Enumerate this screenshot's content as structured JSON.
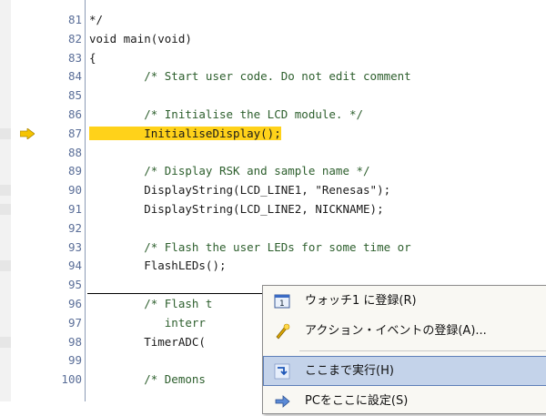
{
  "editor": {
    "lines": [
      {
        "no": "81",
        "code": "*/",
        "kind": "plain",
        "mark": false
      },
      {
        "no": "82",
        "code": "void main(void)",
        "kind": "plain",
        "mark": false
      },
      {
        "no": "83",
        "code": "{",
        "kind": "plain",
        "mark": false
      },
      {
        "no": "84",
        "code": "        /* Start user code. Do not edit comment",
        "kind": "comment",
        "mark": false
      },
      {
        "no": "85",
        "code": "",
        "kind": "plain",
        "mark": false
      },
      {
        "no": "86",
        "code": "        /* Initialise the LCD module. */",
        "kind": "comment",
        "mark": false
      },
      {
        "no": "87",
        "code": "        InitialiseDisplay();",
        "kind": "plain",
        "mark": true,
        "current": true
      },
      {
        "no": "88",
        "code": "",
        "kind": "plain",
        "mark": false
      },
      {
        "no": "89",
        "code": "        /* Display RSK and sample name */",
        "kind": "comment",
        "mark": false
      },
      {
        "no": "90",
        "code": "        DisplayString(LCD_LINE1, \"Renesas\");",
        "kind": "string",
        "mark": true
      },
      {
        "no": "91",
        "code": "        DisplayString(LCD_LINE2, NICKNAME);",
        "kind": "plain",
        "mark": true
      },
      {
        "no": "92",
        "code": "",
        "kind": "plain",
        "mark": false
      },
      {
        "no": "93",
        "code": "        /* Flash the user LEDs for some time or",
        "kind": "comment",
        "mark": false
      },
      {
        "no": "94",
        "code": "        FlashLEDs();",
        "kind": "plain",
        "mark": true
      },
      {
        "no": "95",
        "code": "",
        "kind": "plain",
        "mark": false
      },
      {
        "no": "96",
        "code": "        /* Flash t",
        "kind": "comment",
        "mark": false
      },
      {
        "no": "97",
        "code": "           interr",
        "kind": "comment",
        "mark": false
      },
      {
        "no": "98",
        "code": "        TimerADC(",
        "kind": "plain",
        "mark": true
      },
      {
        "no": "99",
        "code": "",
        "kind": "plain",
        "mark": false
      },
      {
        "no": "100",
        "code": "        /* Demons",
        "kind": "comment",
        "mark": false
      }
    ],
    "current_line_icon": "yellow-arrow-icon"
  },
  "context_menu": {
    "items": [
      {
        "label": "ウォッチ1 に登録(R)",
        "icon": "watch-window-icon",
        "selected": false
      },
      {
        "label": "アクション・イベントの登録(A)...",
        "icon": "action-event-icon",
        "selected": false
      },
      {
        "label": "ここまで実行(H)",
        "icon": "run-to-here-icon",
        "selected": true
      },
      {
        "label": "PCをここに設定(S)",
        "icon": "set-pc-icon",
        "selected": false
      }
    ]
  },
  "colors": {
    "current_line_highlight": "#ffd21a",
    "menu_selected": "#c4d3ea",
    "line_number": "#5a6e98"
  }
}
